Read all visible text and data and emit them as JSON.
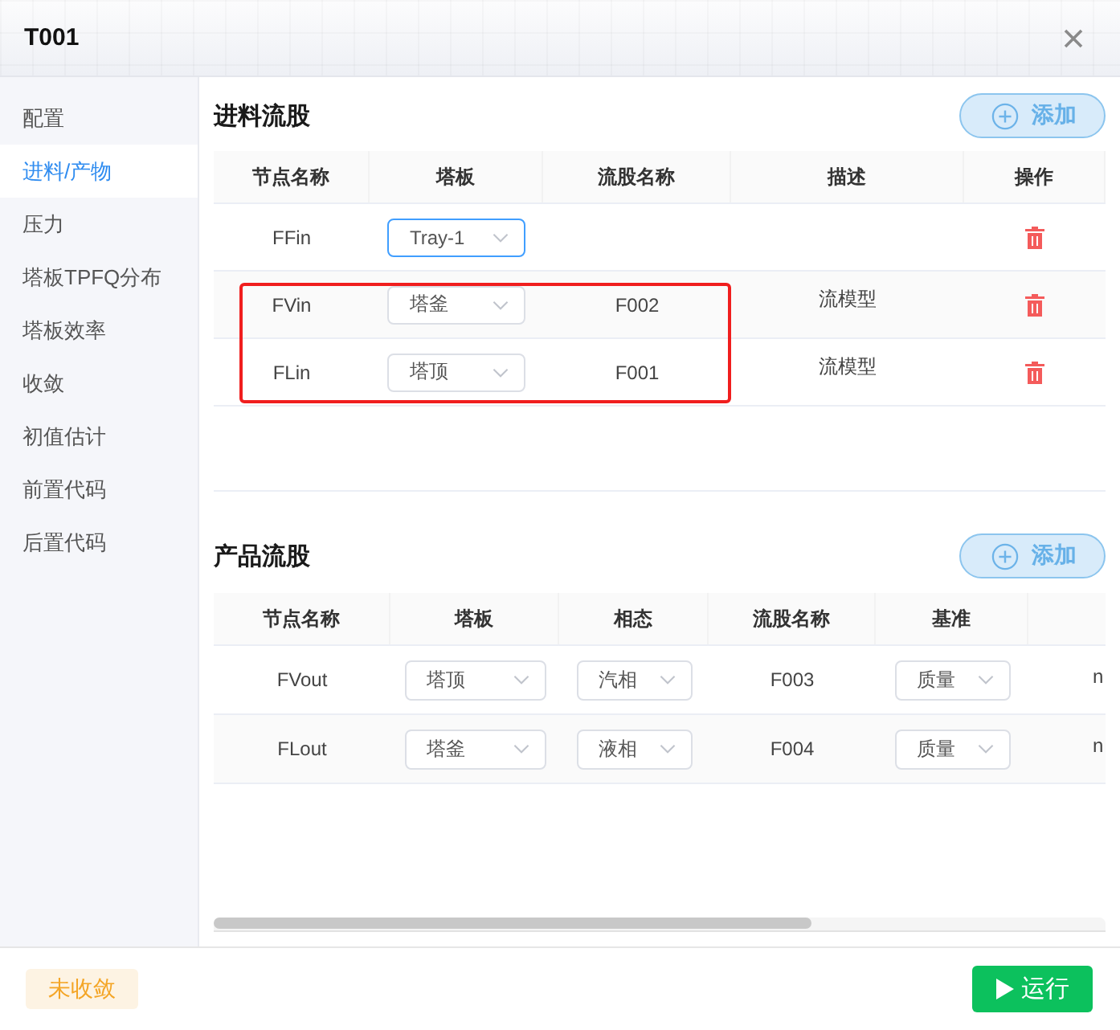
{
  "window": {
    "title": "T001"
  },
  "sidebar": {
    "items": [
      {
        "label": "配置",
        "selected": false
      },
      {
        "label": "进料/产物",
        "selected": true
      },
      {
        "label": "压力",
        "selected": false
      },
      {
        "label": "塔板TPFQ分布",
        "selected": false
      },
      {
        "label": "塔板效率",
        "selected": false
      },
      {
        "label": "收敛",
        "selected": false
      },
      {
        "label": "初值估计",
        "selected": false
      },
      {
        "label": "前置代码",
        "selected": false
      },
      {
        "label": "后置代码",
        "selected": false
      }
    ]
  },
  "feed_streams": {
    "title": "进料流股",
    "add_button": "添加",
    "columns": [
      "节点名称",
      "塔板",
      "流股名称",
      "描述",
      "操作"
    ],
    "rows": [
      {
        "node": "FFin",
        "tray": {
          "value": "Tray-1",
          "focused": true
        },
        "highlighted": false
      },
      {
        "node": "FVin",
        "tray": {
          "value": "塔釜",
          "focused": false
        },
        "stream": "F002",
        "description": "流模型",
        "highlighted": true
      },
      {
        "node": "FLin",
        "tray": {
          "value": "塔顶",
          "focused": false
        },
        "stream": "F001",
        "description": "流模型",
        "highlighted": true
      }
    ]
  },
  "product_streams": {
    "title": "产品流股",
    "add_button": "添加",
    "columns": [
      "节点名称",
      "塔板",
      "相态",
      "流股名称",
      "基准"
    ],
    "rows": [
      {
        "node": "FVout",
        "tray": {
          "value": "塔顶",
          "focused": false
        },
        "phase": {
          "value": "汽相",
          "focused": false
        },
        "stream": "F003",
        "basis": {
          "value": "质量",
          "focused": false
        },
        "column_6": "n"
      },
      {
        "node": "FLout",
        "tray": {
          "value": "塔釜",
          "focused": false
        },
        "phase": {
          "value": "液相",
          "focused": false
        },
        "stream": "F004",
        "basis": {
          "value": "质量",
          "focused": false
        },
        "column_6": "n"
      }
    ]
  },
  "footer": {
    "status": {
      "label": "未收敛",
      "converged": false
    },
    "run_button": "运行"
  }
}
